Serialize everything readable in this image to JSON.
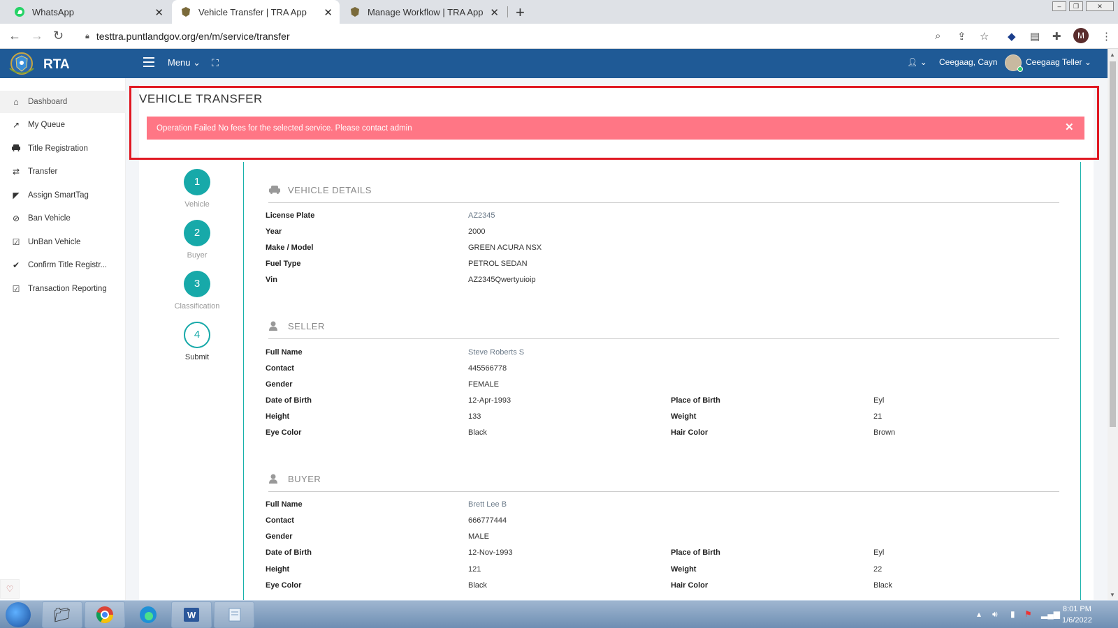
{
  "browser": {
    "tabs": [
      {
        "label": "WhatsApp"
      },
      {
        "label": "Vehicle Transfer | TRA App"
      },
      {
        "label": "Manage Workflow | TRA App"
      }
    ],
    "url": "testtra.puntlandgov.org/en/m/service/transfer",
    "profile_initial": "M"
  },
  "header": {
    "brand": "RTA",
    "menu_label": "Menu",
    "user_name": "Ceegaag, Cayn",
    "role": "Ceegaag Teller"
  },
  "sidebar": {
    "items": [
      {
        "label": "Dashboard",
        "icon": "home-icon"
      },
      {
        "label": "My Queue",
        "icon": "trend-icon"
      },
      {
        "label": "Title Registration",
        "icon": "car-icon"
      },
      {
        "label": "Transfer",
        "icon": "exchange-icon"
      },
      {
        "label": "Assign SmartTag",
        "icon": "tags-icon"
      },
      {
        "label": "Ban Vehicle",
        "icon": "ban-icon"
      },
      {
        "label": "UnBan Vehicle",
        "icon": "check-square-icon"
      },
      {
        "label": "Confirm Title Registr...",
        "icon": "check-icon"
      },
      {
        "label": "Transaction Reporting",
        "icon": "check-square-icon"
      }
    ]
  },
  "page": {
    "title": "VEHICLE TRANSFER",
    "alert": "Operation Failed No fees for the selected service. Please contact admin"
  },
  "steps": [
    {
      "num": "1",
      "label": "Vehicle"
    },
    {
      "num": "2",
      "label": "Buyer"
    },
    {
      "num": "3",
      "label": "Classification"
    },
    {
      "num": "4",
      "label": "Submit"
    }
  ],
  "vehicle": {
    "heading": "VEHICLE DETAILS",
    "rows": [
      {
        "k": "License Plate",
        "v": "AZ2345"
      },
      {
        "k": "Year",
        "v": "2000"
      },
      {
        "k": "Make / Model",
        "v": "GREEN ACURA NSX"
      },
      {
        "k": "Fuel Type",
        "v": "PETROL SEDAN"
      },
      {
        "k": "Vin",
        "v": "AZ2345Qwertyuioip"
      }
    ]
  },
  "seller": {
    "heading": "SELLER",
    "full_name_k": "Full Name",
    "full_name": "Steve Roberts S",
    "contact_k": "Contact",
    "contact": "445566778",
    "gender_k": "Gender",
    "gender": "FEMALE",
    "dob_k": "Date of Birth",
    "dob": "12-Apr-1993",
    "pob_k": "Place of Birth",
    "pob": "Eyl",
    "height_k": "Height",
    "height": "133",
    "weight_k": "Weight",
    "weight": "21",
    "eye_k": "Eye Color",
    "eye": "Black",
    "hair_k": "Hair Color",
    "hair": "Brown"
  },
  "buyer": {
    "heading": "BUYER",
    "full_name_k": "Full Name",
    "full_name": "Brett Lee B",
    "contact_k": "Contact",
    "contact": "666777444",
    "gender_k": "Gender",
    "gender": "MALE",
    "dob_k": "Date of Birth",
    "dob": "12-Nov-1993",
    "pob_k": "Place of Birth",
    "pob": "Eyl",
    "height_k": "Height",
    "height": "121",
    "weight_k": "Weight",
    "weight": "22",
    "eye_k": "Eye Color",
    "eye": "Black",
    "hair_k": "Hair Color",
    "hair": "Black"
  },
  "taskbar": {
    "time": "8:01 PM",
    "date": "1/6/2022"
  }
}
